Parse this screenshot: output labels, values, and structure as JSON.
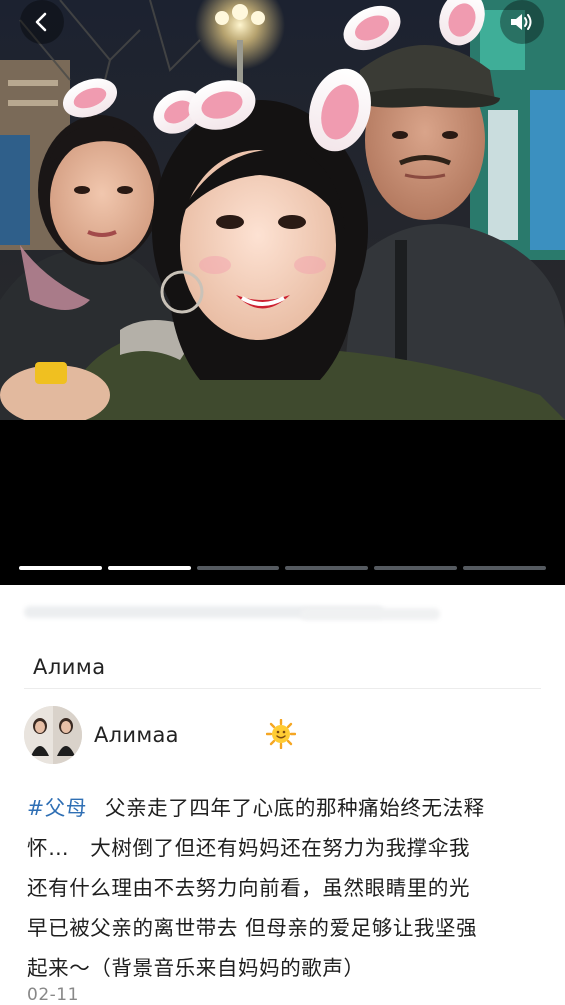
{
  "colors": {
    "hashtag": "#2f6fb4",
    "progress_active": "#ffffff",
    "progress_inactive": "#555a60"
  },
  "media": {
    "back_icon": "chevron-left-icon",
    "sound_icon": "speaker-volume-icon",
    "progress_segments": 6,
    "progress_active_count": 2,
    "photo_alt": "Selfie of three people at night with bunny-ear filter"
  },
  "post": {
    "title": "Алима",
    "author": {
      "name": "Алимаа",
      "emoji": "sun-with-face-icon"
    },
    "hashtag": "#父母",
    "description_lines": [
      "父亲走了四年了心底的那种痛始终无法释",
      "怀…　大树倒了但还有妈妈还在努力为我撑伞我",
      "还有什么理由不去努力向前看，虽然眼睛里的光",
      "早已被父亲的离世带去 但母亲的爱足够让我坚强",
      "起来～（背景音乐来自妈妈的歌声）"
    ],
    "date": "02-11"
  }
}
